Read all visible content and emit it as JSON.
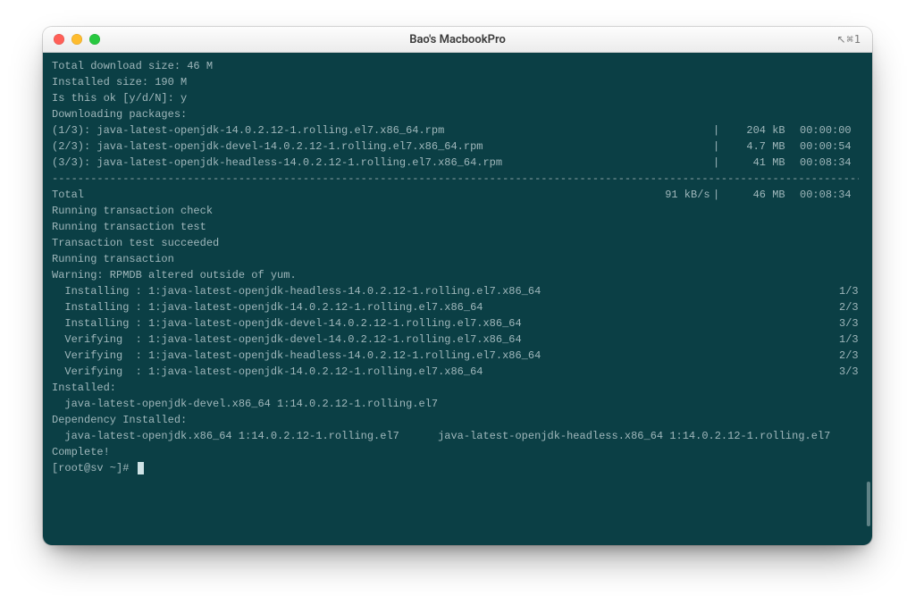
{
  "window": {
    "title": "Bao's MacbookPro",
    "shortcut_hint": "⌘1"
  },
  "term": {
    "preamble": [
      "",
      "Total download size: 46 M",
      "Installed size: 190 M",
      "Is this ok [y/d/N]: y",
      "Downloading packages:"
    ],
    "downloads": [
      {
        "left": "(1/3): java-latest-openjdk-14.0.2.12-1.rolling.el7.x86_64.rpm",
        "size": "204 kB",
        "time": "00:00:00"
      },
      {
        "left": "(2/3): java-latest-openjdk-devel-14.0.2.12-1.rolling.el7.x86_64.rpm",
        "size": "4.7 MB",
        "time": "00:00:54"
      },
      {
        "left": "(3/3): java-latest-openjdk-headless-14.0.2.12-1.rolling.el7.x86_64.rpm",
        "size": " 41 MB",
        "time": "00:08:34"
      }
    ],
    "total_row": {
      "left": "Total",
      "rate": "91 kB/s",
      "size": " 46 MB",
      "time": "00:08:34"
    },
    "midlines": [
      "Running transaction check",
      "Running transaction test",
      "Transaction test succeeded",
      "Running transaction",
      "Warning: RPMDB altered outside of yum."
    ],
    "steps": [
      {
        "left": "  Installing : 1:java-latest-openjdk-headless-14.0.2.12-1.rolling.el7.x86_64",
        "right": "1/3"
      },
      {
        "left": "  Installing : 1:java-latest-openjdk-14.0.2.12-1.rolling.el7.x86_64",
        "right": "2/3"
      },
      {
        "left": "  Installing : 1:java-latest-openjdk-devel-14.0.2.12-1.rolling.el7.x86_64",
        "right": "3/3"
      },
      {
        "left": "  Verifying  : 1:java-latest-openjdk-devel-14.0.2.12-1.rolling.el7.x86_64",
        "right": "1/3"
      },
      {
        "left": "  Verifying  : 1:java-latest-openjdk-headless-14.0.2.12-1.rolling.el7.x86_64",
        "right": "2/3"
      },
      {
        "left": "  Verifying  : 1:java-latest-openjdk-14.0.2.12-1.rolling.el7.x86_64",
        "right": "3/3"
      }
    ],
    "trailer": [
      "",
      "Installed:",
      "  java-latest-openjdk-devel.x86_64 1:14.0.2.12-1.rolling.el7",
      "",
      "Dependency Installed:",
      "  java-latest-openjdk.x86_64 1:14.0.2.12-1.rolling.el7      java-latest-openjdk-headless.x86_64 1:14.0.2.12-1.rolling.el7",
      "",
      "Complete!"
    ],
    "prompt": "[root@sv ~]# "
  },
  "colors": {
    "term_bg": "#0b3f45",
    "term_fg": "#9fb7bb",
    "traffic_red": "#ff5f57",
    "traffic_yellow": "#febc2e",
    "traffic_green": "#28c840"
  }
}
